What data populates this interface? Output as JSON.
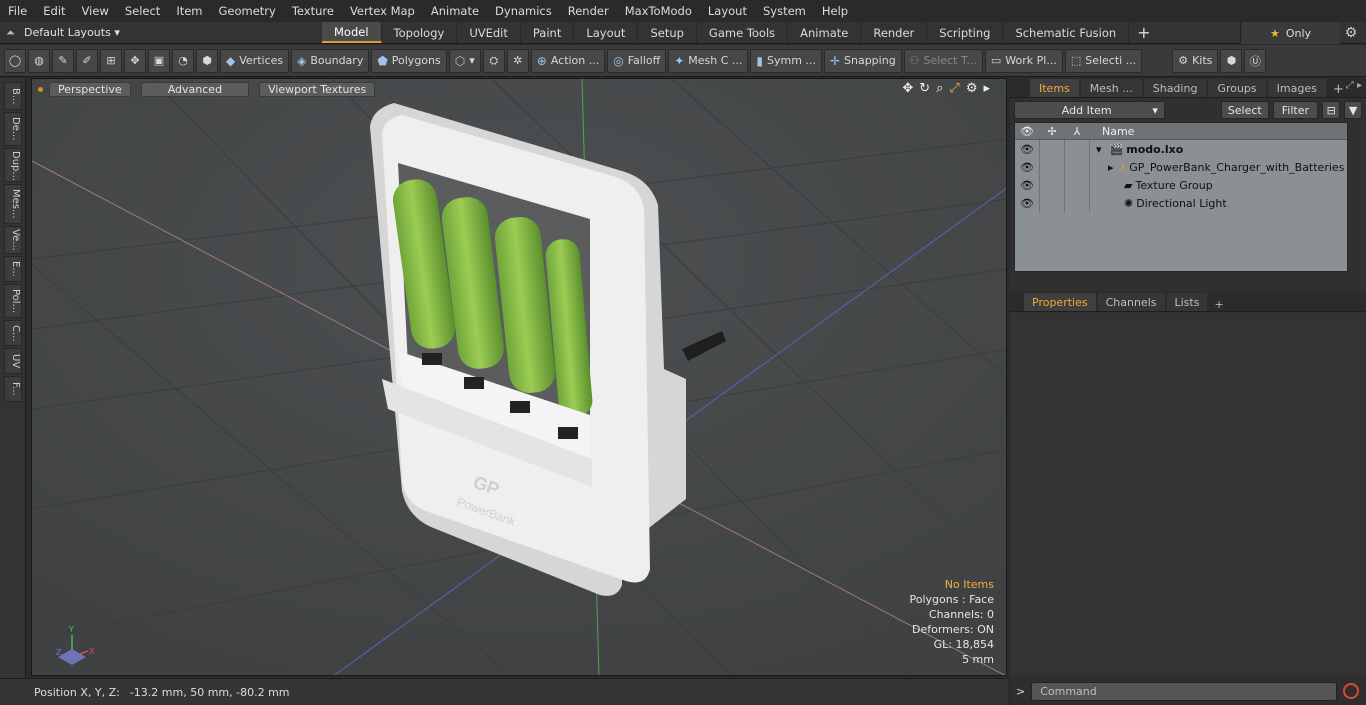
{
  "menu": [
    "File",
    "Edit",
    "View",
    "Select",
    "Item",
    "Geometry",
    "Texture",
    "Vertex Map",
    "Animate",
    "Dynamics",
    "Render",
    "MaxToModo",
    "Layout",
    "System",
    "Help"
  ],
  "layout_selector": "Default Layouts",
  "layout_tabs": [
    "Model",
    "Topology",
    "UVEdit",
    "Paint",
    "Layout",
    "Setup",
    "Game Tools",
    "Animate",
    "Render",
    "Scripting",
    "Schematic Fusion"
  ],
  "active_layout_tab": "Model",
  "only_label": "Only",
  "toolbar": {
    "vertices": "Vertices",
    "boundary": "Boundary",
    "polygons": "Polygons",
    "action": "Action ...",
    "falloff": "Falloff",
    "mesh": "Mesh C ...",
    "symm": "Symm ...",
    "snapping": "Snapping",
    "select_t": "Select T...",
    "work_plane": "Work Pl...",
    "selecti": "Selecti ...",
    "kits": "Kits"
  },
  "left_tabs": [
    "B...",
    "De...",
    "Dup...",
    "Mes...",
    "Ve...",
    "E...",
    "Pol...",
    "C...",
    "UV",
    "F..."
  ],
  "viewport": {
    "perspective": "Perspective",
    "advanced": "Advanced",
    "textures": "Viewport Textures",
    "stats": {
      "no_items": "No Items",
      "polygons": "Polygons : Face",
      "channels": "Channels: 0",
      "deformers": "Deformers: ON",
      "gl": "GL: 18,854",
      "unit": "5 mm"
    },
    "axis_labels": {
      "x": "X",
      "y": "Y",
      "z": "Z"
    },
    "brand_text": "GP",
    "brand_sub": "PowerBank"
  },
  "status": {
    "label": "Position X, Y, Z:",
    "value": "-13.2 mm, 50 mm, -80.2 mm"
  },
  "items_panel": {
    "tabs": [
      "Items",
      "Mesh ...",
      "Shading",
      "Groups",
      "Images"
    ],
    "active_tab": "Items",
    "add_item": "Add Item",
    "select": "Select",
    "filter": "Filter",
    "col_name": "Name",
    "rows": [
      {
        "name": "modo.lxo",
        "bold": true
      },
      {
        "name": "GP_PowerBank_Charger_with_Batteries",
        "bold": false
      },
      {
        "name": "Texture Group",
        "bold": false
      },
      {
        "name": "Directional Light",
        "bold": false
      }
    ]
  },
  "properties_panel": {
    "tabs": [
      "Properties",
      "Channels",
      "Lists"
    ],
    "active_tab": "Properties"
  },
  "command_placeholder": "Command"
}
